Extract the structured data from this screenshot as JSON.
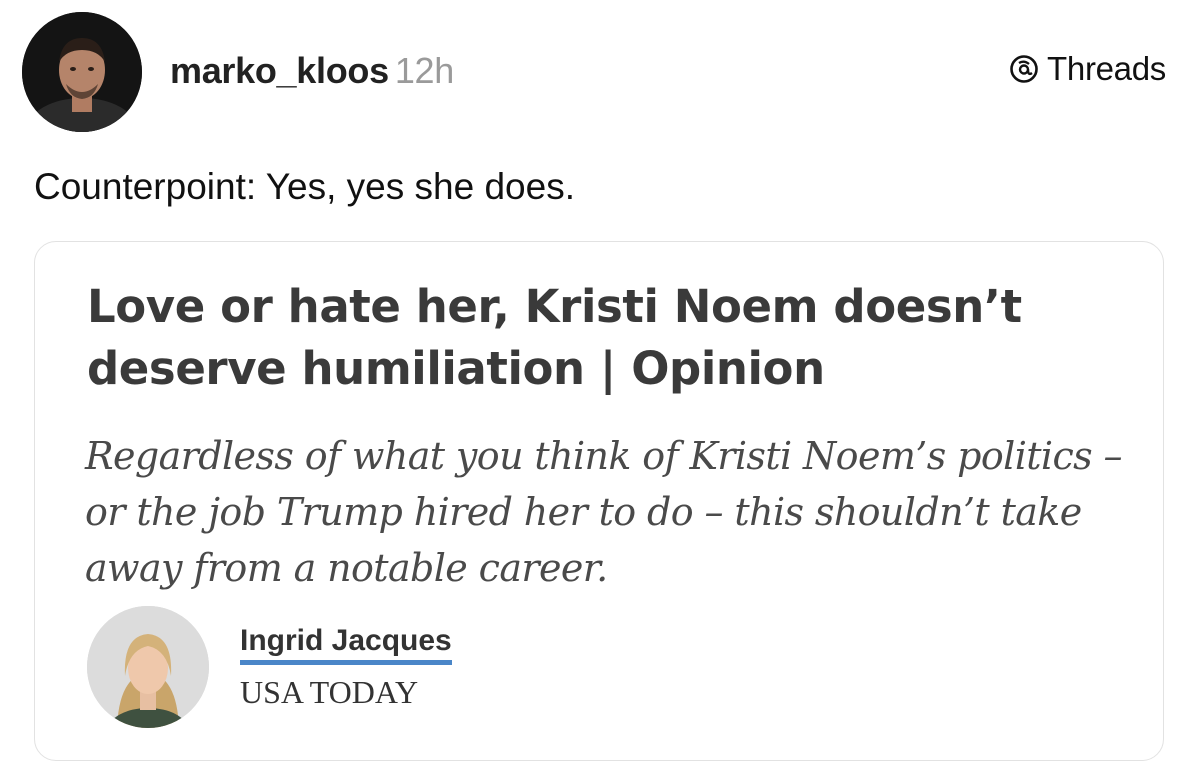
{
  "post": {
    "username": "marko_kloos",
    "timestamp": "12h",
    "brand": "Threads",
    "text": "Counterpoint: Yes, yes she does."
  },
  "link_card": {
    "headline": "Love or hate her, Kristi Noem doesn’t deserve humiliation | Opinion",
    "deck": "Regardless of what you think of Kristi Noem’s politics – or the job Trump hired her to do – this shouldn’t take away from a notable career.",
    "author_name": "Ingrid Jacques",
    "author_outlet": "USA TODAY"
  },
  "icons": {
    "brand_logo": "threads-logo-icon"
  }
}
